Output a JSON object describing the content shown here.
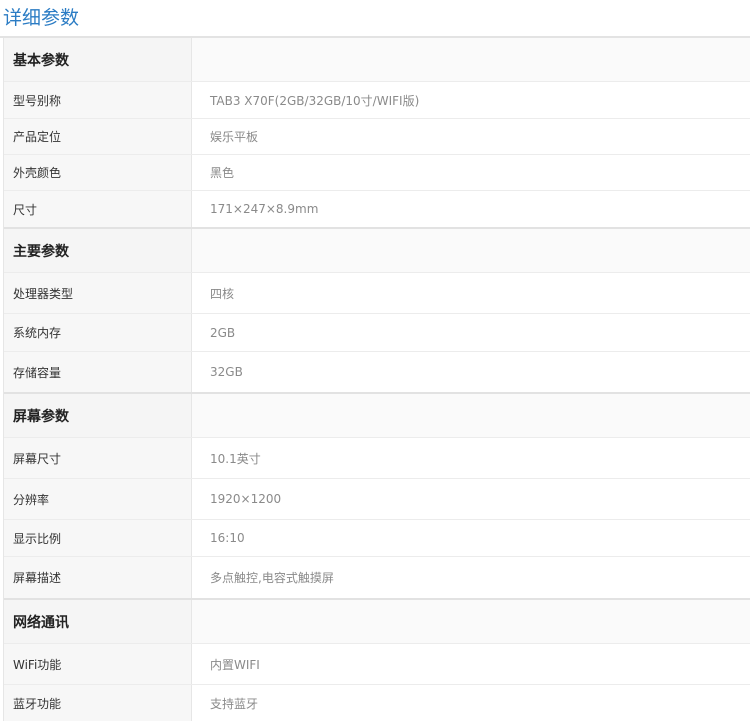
{
  "page": {
    "title": "详细参数"
  },
  "sections": [
    {
      "header": "基本参数",
      "rows": [
        {
          "label": "型号别称",
          "value": "TAB3 X70F(2GB/32GB/10寸/WIFI版)"
        },
        {
          "label": "产品定位",
          "value": "娱乐平板"
        },
        {
          "label": "外壳颜色",
          "value": "黑色"
        },
        {
          "label": "尺寸",
          "value": "171×247×8.9mm"
        }
      ]
    },
    {
      "header": "主要参数",
      "rows": [
        {
          "label": "处理器类型",
          "value": "四核"
        },
        {
          "label": "系统内存",
          "value": "2GB"
        },
        {
          "label": "存储容量",
          "value": "32GB"
        }
      ]
    },
    {
      "header": "屏幕参数",
      "rows": [
        {
          "label": "屏幕尺寸",
          "value": "10.1英寸"
        },
        {
          "label": "分辨率",
          "value": "1920×1200"
        },
        {
          "label": "显示比例",
          "value": "16:10"
        },
        {
          "label": "屏幕描述",
          "value": "多点触控,电容式触摸屏"
        }
      ]
    },
    {
      "header": "网络通讯",
      "rows": [
        {
          "label": "WiFi功能",
          "value": "内置WIFI"
        },
        {
          "label": "蓝牙功能",
          "value": "支持蓝牙"
        }
      ]
    }
  ],
  "colors": {
    "title": "#2b7cc4",
    "header_bg": "#f5f5f5",
    "label_bg": "#f7f7f7",
    "value_text": "#8a8a8a"
  }
}
